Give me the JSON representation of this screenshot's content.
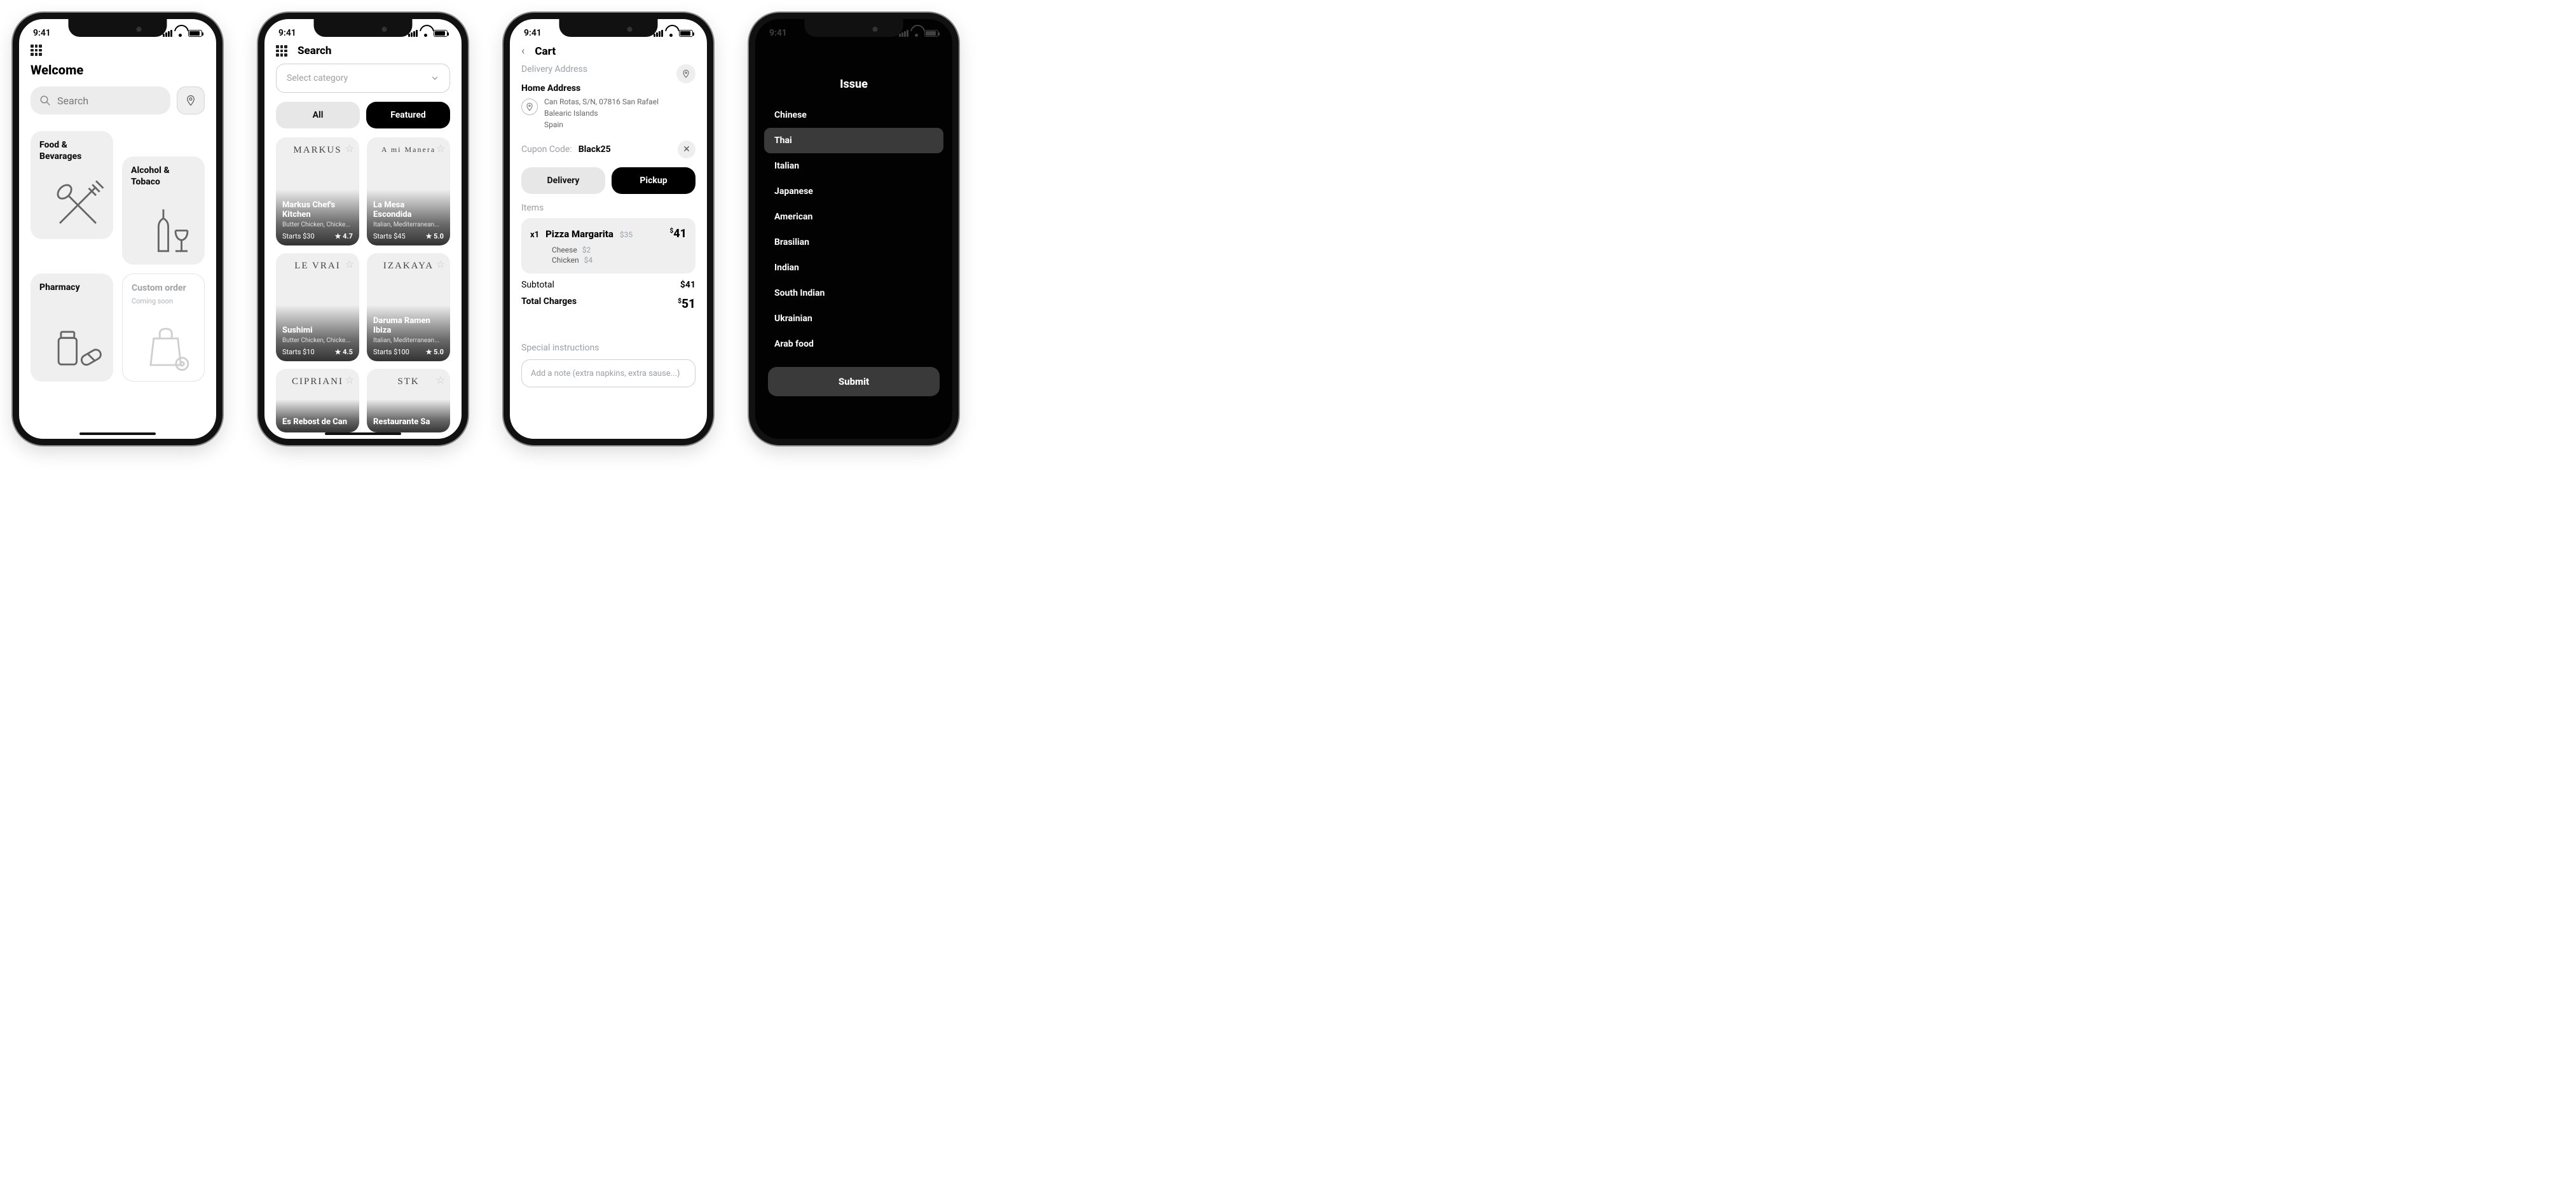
{
  "statusbar": {
    "time": "9:41"
  },
  "s1": {
    "title": "Welcome",
    "search_placeholder": "Search",
    "cats": {
      "food": "Food & Bevarages",
      "alcohol": "Alcohol & Tobaco",
      "pharmacy": "Pharmacy",
      "custom": "Custom order",
      "custom_sub": "Coming soon"
    }
  },
  "s2": {
    "title": "Search",
    "select": "Select category",
    "tab_all": "All",
    "tab_featured": "Featured",
    "restaurants": [
      {
        "name": "Markus Chef's Kitchen",
        "desc": "Butter Chicken, Chicke...",
        "price": "Starts $30",
        "rating": "4.7",
        "logo": "MARKUS"
      },
      {
        "name": "La Mesa Escondida",
        "desc": "Italian, Mediterranean...",
        "price": "Starts $45",
        "rating": "5.0",
        "logo": "A mi Manera"
      },
      {
        "name": "Sushimi",
        "desc": "Butter Chicken, Chicke...",
        "price": "Starts $10",
        "rating": "4.5",
        "logo": "LE VRAI"
      },
      {
        "name": "Daruma Ramen Ibiza",
        "desc": "Italian, Mediterranean...",
        "price": "Starts $100",
        "rating": "5.0",
        "logo": "IZAKAYA"
      },
      {
        "name": "Es Rebost de Can",
        "desc": "",
        "price": "",
        "rating": "",
        "logo": "CIPRIANI"
      },
      {
        "name": "Restaurante Sa",
        "desc": "",
        "price": "",
        "rating": "",
        "logo": "STK"
      }
    ]
  },
  "s3": {
    "title": "Cart",
    "delivery_label": "Delivery Address",
    "addr_title": "Home Address",
    "addr_l1": "Can Rotas, S/N, 07816 San Rafael",
    "addr_l2": "Balearic Islands",
    "addr_l3": "Spain",
    "coupon_label": "Cupon Code:",
    "coupon_value": "Black25",
    "tab_delivery": "Delivery",
    "tab_pickup": "Pickup",
    "items_label": "Items",
    "item": {
      "qty": "x1",
      "name": "Pizza Margarita",
      "base_price": "$35",
      "total": "41",
      "extras": [
        {
          "n": "Cheese",
          "p": "$2"
        },
        {
          "n": "Chicken",
          "p": "$4"
        }
      ]
    },
    "subtotal_label": "Subtotal",
    "subtotal": "$41",
    "total_label": "Total Charges",
    "total": "51",
    "special_label": "Special instructions",
    "note_placeholder": "Add a note (extra napkins, extra sause...)"
  },
  "s4": {
    "title": "Issue",
    "cuisines": [
      "Chinese",
      "Thai",
      "Italian",
      "Japanese",
      "American",
      "Brasilian",
      "Indian",
      "South Indian",
      "Ukrainian",
      "Arab food"
    ],
    "selected": "Thai",
    "submit": "Submit"
  }
}
